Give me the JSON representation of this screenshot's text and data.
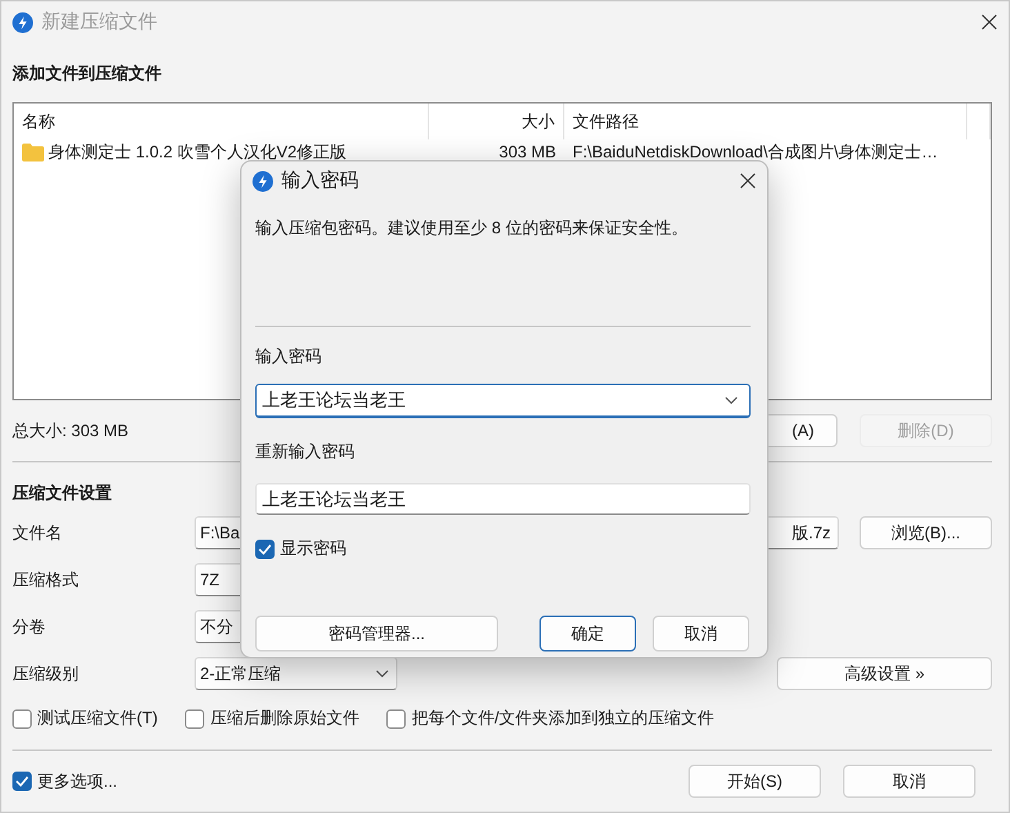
{
  "window": {
    "title": "新建压缩文件"
  },
  "add_section": {
    "heading": "添加文件到压缩文件"
  },
  "file_list": {
    "columns": [
      "名称",
      "大小",
      "文件路径"
    ],
    "rows": [
      {
        "name": "身体测定士 1.0.2 吹雪个人汉化V2修正版",
        "size": "303 MB",
        "path": "F:\\BaiduNetdiskDownload\\合成图片\\身体测定士…"
      }
    ]
  },
  "total_size": "总大小: 303 MB",
  "list_buttons": [
    {
      "label": "(A)",
      "disabled": false
    },
    {
      "label": "删除(D)",
      "disabled": true
    }
  ],
  "settings": {
    "heading": "压缩文件设置",
    "rows": [
      {
        "kind": "text",
        "label": "文件名",
        "value_start": "F:\\Ba",
        "value_end": "版.7z",
        "button": "浏览(B)..."
      },
      {
        "kind": "select",
        "label": "压缩格式",
        "value": "7Z"
      },
      {
        "kind": "select",
        "label": "分卷",
        "value": "不分"
      },
      {
        "kind": "select",
        "label": "压缩级别",
        "value": "2-正常压缩",
        "caret": true,
        "button": "高级设置 »"
      }
    ]
  },
  "options": [
    {
      "label": "测试压缩文件(T)",
      "checked": false
    },
    {
      "label": "压缩后删除原始文件",
      "checked": false
    },
    {
      "label": "把每个文件/文件夹添加到独立的压缩文件",
      "checked": false
    }
  ],
  "more_options": {
    "label": "更多选项...",
    "checked": true
  },
  "footer_buttons": [
    "开始(S)",
    "取消"
  ],
  "dialog": {
    "title": "输入密码",
    "message": "输入压缩包密码。建议使用至少 8 位的密码来保证安全性。",
    "password_label": "输入密码",
    "password": "上老王论坛当老王",
    "confirm_label": "重新输入密码",
    "confirm": "上老王论坛当老王",
    "show_password": {
      "label": "显示密码",
      "checked": true
    },
    "buttons": [
      {
        "label": "密码管理器...",
        "kind": "wide",
        "default": false
      },
      {
        "label": "确定",
        "kind": "normal",
        "default": true
      },
      {
        "label": "取消",
        "kind": "normal",
        "default": false
      }
    ]
  }
}
